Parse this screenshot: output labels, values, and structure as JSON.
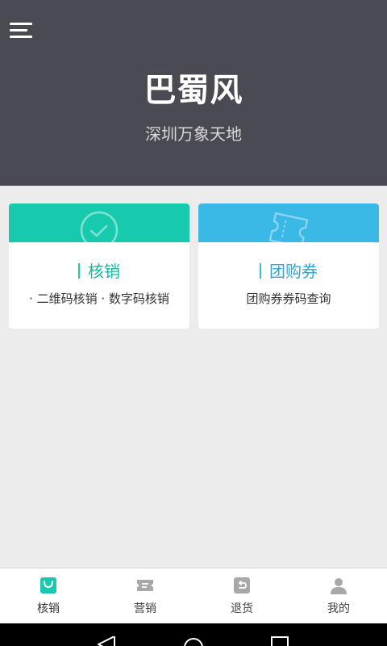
{
  "header": {
    "store_name": "巴蜀风",
    "store_location": "深圳万象天地",
    "menu_icon": "hamburger-menu-icon",
    "background": "#4a4a52"
  },
  "cards": [
    {
      "title": "核销",
      "description": "· 二维码核销 · 数字码核销",
      "icon": "check-circle-icon",
      "color": "#17c9ad"
    },
    {
      "title": "团购券",
      "description": "团购券券码查询",
      "icon": "ticket-icon",
      "color": "#3bb9e6"
    }
  ],
  "bottom_nav": {
    "items": [
      {
        "label": "核销",
        "icon": "shopping-bag-icon",
        "active": true
      },
      {
        "label": "营销",
        "icon": "coupon-icon",
        "active": false
      },
      {
        "label": "退货",
        "icon": "return-icon",
        "active": false
      },
      {
        "label": "我的",
        "icon": "user-icon",
        "active": false
      }
    ],
    "active_color": "#17c9ad",
    "inactive_color": "#a8a8a8"
  },
  "system_bar": {
    "buttons": [
      "back-icon",
      "home-icon",
      "recents-icon"
    ]
  }
}
